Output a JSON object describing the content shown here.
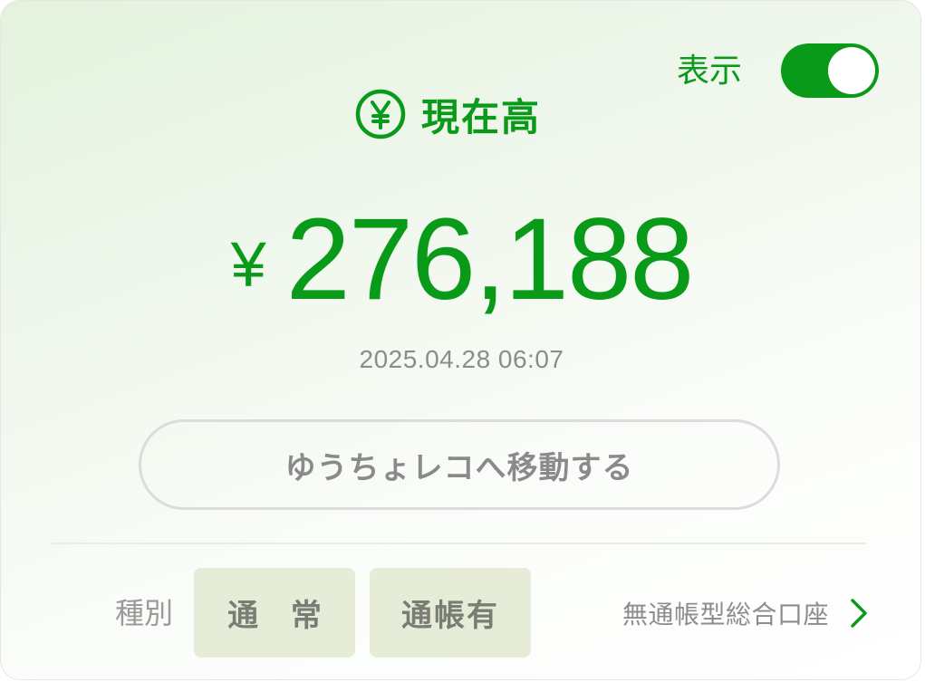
{
  "toggle": {
    "label": "表示",
    "on": true
  },
  "header": {
    "title": "現在高",
    "icon": "yen-circle-icon"
  },
  "balance": {
    "currency": "¥",
    "amount": "276,188",
    "timestamp": "2025.04.28 06:07"
  },
  "actions": {
    "move_button": "ゆうちょレコへ移動する"
  },
  "account_type": {
    "label": "種別",
    "chips": [
      "通 常",
      "通帳有"
    ],
    "link_text": "無通帳型総合口座"
  },
  "colors": {
    "accent": "#0a9a1a",
    "muted": "#8c8c8c",
    "chip_bg": "#e6ecd8"
  }
}
